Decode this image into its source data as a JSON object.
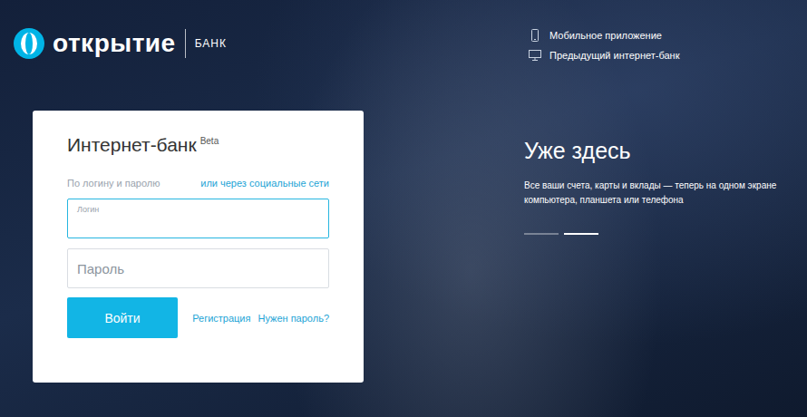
{
  "logo": {
    "name": "открытие",
    "suffix": "БАНК"
  },
  "top_links": [
    {
      "label": "Мобильное приложение",
      "kind": "mobile"
    },
    {
      "label": "Предыдущий интернет-банк",
      "kind": "desktop"
    }
  ],
  "login": {
    "title": "Интернет-банк",
    "badge": "Beta",
    "mode_label": "По логину и паролю",
    "social_link": "или через социальные сети",
    "fields": [
      {
        "label": "Логин",
        "focused": true
      },
      {
        "label": "Пароль",
        "focused": false
      }
    ],
    "submit": "Войти",
    "links": [
      "Регистрация",
      "Нужен пароль?"
    ]
  },
  "promo": {
    "title": "Уже здесь",
    "text": "Все ваши счета, карты и вклады — теперь на одном экране компьютера, планшета или телефона",
    "slides": [
      {
        "selected": false
      },
      {
        "selected": true
      }
    ]
  }
}
